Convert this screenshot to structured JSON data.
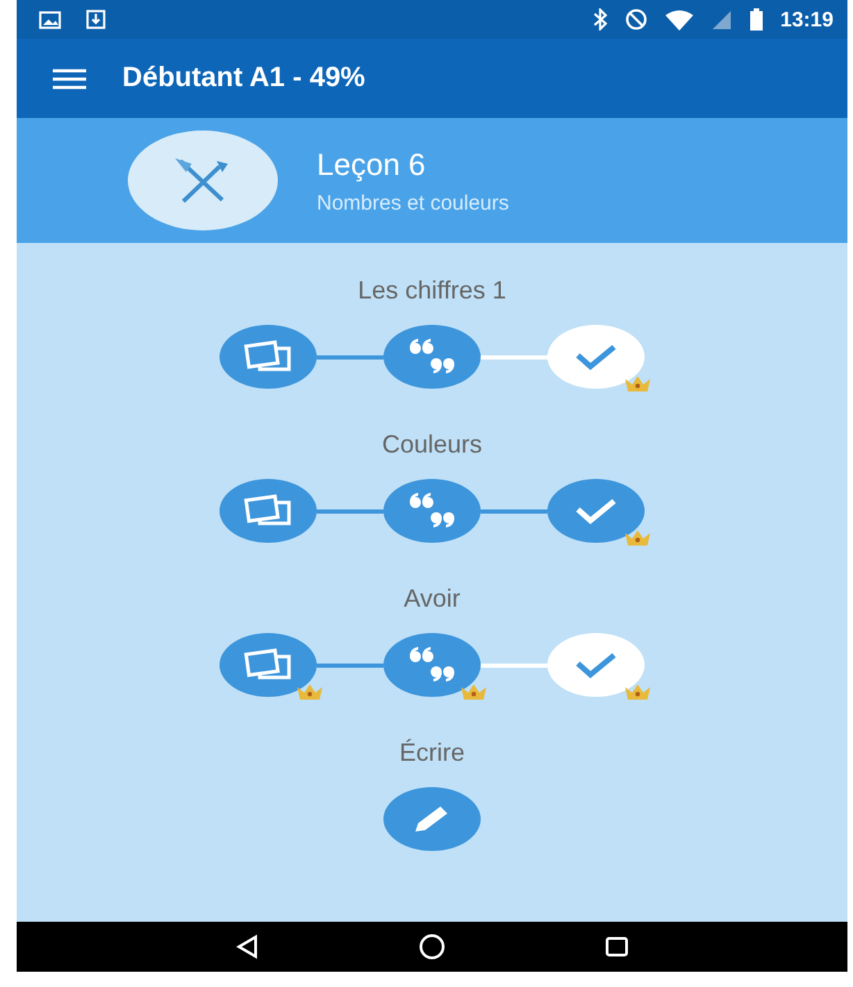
{
  "status_bar": {
    "time": "13:19"
  },
  "app_bar": {
    "title": "Débutant A1 - 49%"
  },
  "lesson": {
    "title": "Leçon 6",
    "subtitle": "Nombres et couleurs"
  },
  "groups": [
    {
      "title": "Les chiffres 1",
      "steps": [
        {
          "kind": "cards",
          "highlighted": false,
          "crown": false
        },
        {
          "kind": "quote",
          "highlighted": false,
          "crown": false
        },
        {
          "kind": "check",
          "highlighted": true,
          "crown": true
        }
      ]
    },
    {
      "title": "Couleurs",
      "steps": [
        {
          "kind": "cards",
          "highlighted": false,
          "crown": false
        },
        {
          "kind": "quote",
          "highlighted": false,
          "crown": false
        },
        {
          "kind": "check",
          "highlighted": false,
          "crown": true
        }
      ]
    },
    {
      "title": "Avoir",
      "steps": [
        {
          "kind": "cards",
          "highlighted": false,
          "crown": true
        },
        {
          "kind": "quote",
          "highlighted": false,
          "crown": true
        },
        {
          "kind": "check",
          "highlighted": true,
          "crown": true
        }
      ]
    },
    {
      "title": "Écrire",
      "steps": [
        {
          "kind": "pencil",
          "highlighted": false,
          "crown": false
        }
      ]
    }
  ]
}
